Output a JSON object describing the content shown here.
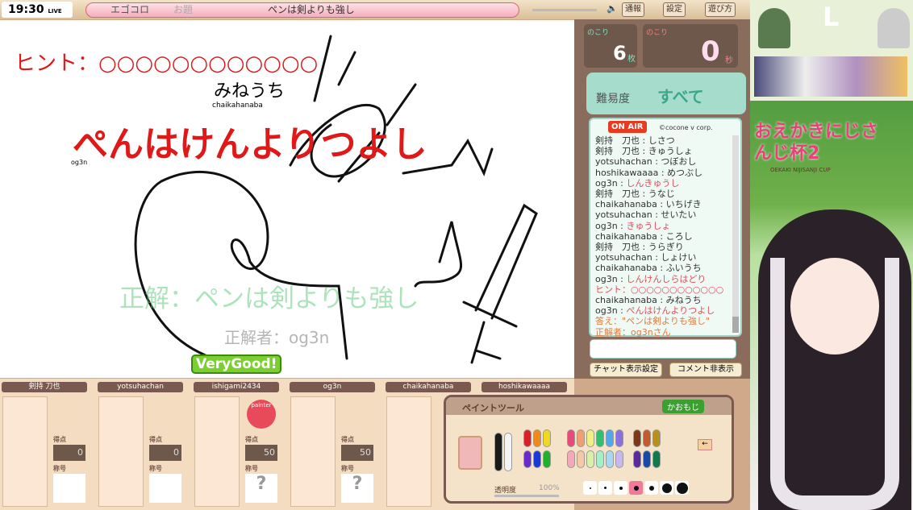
{
  "stream": {
    "time": "19:30",
    "live": "LIVE",
    "corner_letter": "L",
    "logo_title": "おえかきにじさんじ杯2",
    "logo_sub": "OEKAKI NIJISANJI CUP"
  },
  "topbar": {
    "game": "エゴコロ",
    "topic_label": "お題",
    "topic": "ペンは剣よりも強し",
    "report": "通報",
    "settings": "設定",
    "howto": "遊び方"
  },
  "canvas": {
    "hint": "ヒント：○○○○○○○○○○○○",
    "guess1": "みねうち",
    "guess1_user": "chaikahanaba",
    "guess2": "ぺんはけんよりつよし",
    "guess2_user": "og3n",
    "answer": "正解：ペンは剣よりも強し",
    "winner": "正解者：og3n",
    "badge": "VeryGood!"
  },
  "counters": {
    "remaining_label": "のこり",
    "sheets": "6",
    "sheets_unit": "枚",
    "time_label": "のこり",
    "seconds": "0",
    "seconds_unit": "秒"
  },
  "difficulty": {
    "label": "難易度",
    "value": "すべて"
  },
  "chat": {
    "onair": "ON AIR",
    "copyright": "©cocone v corp.",
    "messages": [
      {
        "u": "剣持　刀也",
        "t": "しさつ",
        "c": ""
      },
      {
        "u": "剣持　刀也",
        "t": "きゅうしょ",
        "c": ""
      },
      {
        "u": "yotsuhachan",
        "t": "つぼおし",
        "c": ""
      },
      {
        "u": "hoshikawaaaa",
        "t": "めつぶし",
        "c": ""
      },
      {
        "u": "og3n",
        "t": "しんきゅうし",
        "c": "r"
      },
      {
        "u": "剣持　刀也",
        "t": "うなじ",
        "c": ""
      },
      {
        "u": "chaikahanaba",
        "t": "いちげき",
        "c": ""
      },
      {
        "u": "yotsuhachan",
        "t": "せいたい",
        "c": ""
      },
      {
        "u": "og3n",
        "t": "きゅうしょ",
        "c": "r"
      },
      {
        "u": "chaikahanaba",
        "t": "ころし",
        "c": ""
      },
      {
        "u": "剣持　刀也",
        "t": "うらぎり",
        "c": ""
      },
      {
        "u": "yotsuhachan",
        "t": "しょけい",
        "c": ""
      },
      {
        "u": "chaikahanaba",
        "t": "ふいうち",
        "c": ""
      },
      {
        "u": "og3n",
        "t": "しんけんしらはどり",
        "c": "r"
      },
      {
        "u": "",
        "t": "ヒント：○○○○○○○○○○○○",
        "c": "r"
      },
      {
        "u": "chaikahanaba",
        "t": "みねうち",
        "c": ""
      },
      {
        "u": "og3n",
        "t": "ぺんはけんよりつよし",
        "c": "r"
      },
      {
        "u": "",
        "t": "答え：\"ペンは剣よりも強し\"",
        "c": "o"
      },
      {
        "u": "",
        "t": "正解者：og3nさん",
        "c": "o"
      }
    ],
    "input_placeholder": "",
    "display_settings": "チャット表示設定",
    "hide_comments": "コメント非表示"
  },
  "players": [
    {
      "name": "剣持 刀也",
      "score": "0",
      "title": ""
    },
    {
      "name": "yotsuhachan",
      "score": "0",
      "title": ""
    },
    {
      "name": "ishigami2434",
      "score": "50",
      "title": "?",
      "painter": "painter"
    },
    {
      "name": "og3n",
      "score": "50",
      "title": "?"
    },
    {
      "name": "chaikahanaba",
      "score": "",
      "title": ""
    },
    {
      "name": "hoshikawaaaa",
      "score": "",
      "title": ""
    }
  ],
  "player_labels": {
    "score": "得点",
    "title": "称号"
  },
  "paint": {
    "title": "ペイントツール",
    "emoji_btn": "かおもじ",
    "opacity_label": "透明度",
    "opacity": "100%",
    "opacity_value": 1.0,
    "pens": [
      "#1a1a1a",
      "#f4f4f4",
      "#d8202a",
      "#ee8a1a",
      "#f0d820",
      "#6a2acb",
      "#1a3ad8",
      "#20b02a",
      "#e84a7a",
      "#f0a070",
      "#f0f080",
      "#30c070",
      "#50a8e8",
      "#8a70e0",
      "#7a3a1a",
      "#c05a30",
      "#b89020",
      "#f4a8b8",
      "#f6c8a8",
      "#d8f0a8",
      "#a0f0c8",
      "#a8d8f0",
      "#c8b8f0",
      "#5a2a9a",
      "#1a4aa8",
      "#107a4a"
    ]
  }
}
